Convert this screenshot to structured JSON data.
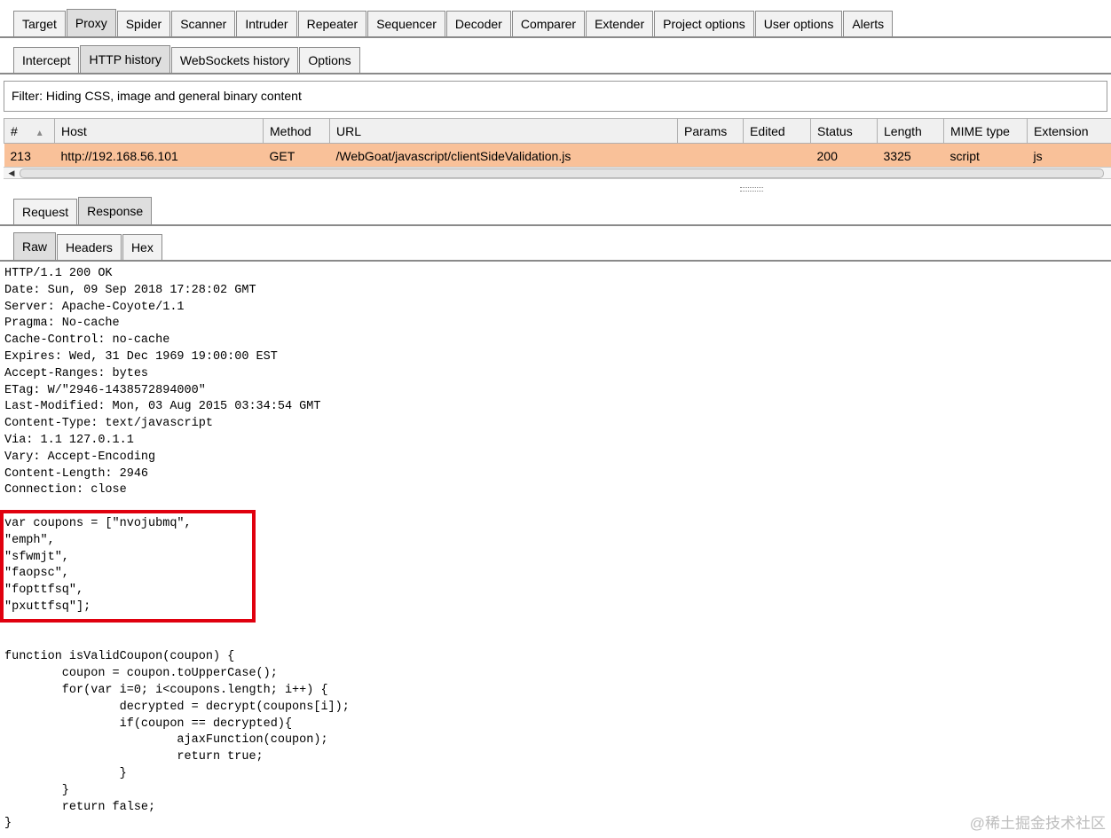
{
  "main_tabs": [
    "Target",
    "Proxy",
    "Spider",
    "Scanner",
    "Intruder",
    "Repeater",
    "Sequencer",
    "Decoder",
    "Comparer",
    "Extender",
    "Project options",
    "User options",
    "Alerts"
  ],
  "main_active": "Proxy",
  "proxy_tabs": [
    "Intercept",
    "HTTP history",
    "WebSockets history",
    "Options"
  ],
  "proxy_active": "HTTP history",
  "filter_text": "Filter: Hiding CSS, image and general binary content",
  "table": {
    "columns": [
      "#",
      "Host",
      "Method",
      "URL",
      "Params",
      "Edited",
      "Status",
      "Length",
      "MIME type",
      "Extension"
    ],
    "rows": [
      [
        "213",
        "http://192.168.56.101",
        "GET",
        "/WebGoat/javascript/clientSideValidation.js",
        "",
        "",
        "200",
        "3325",
        "script",
        "js"
      ]
    ],
    "selected_row_color": "#f9c199"
  },
  "message_tabs": [
    "Request",
    "Response"
  ],
  "message_active": "Response",
  "view_tabs": [
    "Raw",
    "Headers",
    "Hex"
  ],
  "view_active": "Raw",
  "response_lines": [
    "HTTP/1.1 200 OK",
    "Date: Sun, 09 Sep 2018 17:28:02 GMT",
    "Server: Apache-Coyote/1.1",
    "Pragma: No-cache",
    "Cache-Control: no-cache",
    "Expires: Wed, 31 Dec 1969 19:00:00 EST",
    "Accept-Ranges: bytes",
    "ETag: W/\"2946-1438572894000\"",
    "Last-Modified: Mon, 03 Aug 2015 03:34:54 GMT",
    "Content-Type: text/javascript",
    "Via: 1.1 127.0.1.1",
    "Vary: Accept-Encoding",
    "Content-Length: 2946",
    "Connection: close",
    "",
    "var coupons = [\"nvojubmq\",",
    "\"emph\",",
    "\"sfwmjt\",",
    "\"faopsc\",",
    "\"fopttfsq\",",
    "\"pxuttfsq\"];",
    "",
    "",
    "function isValidCoupon(coupon) {",
    "        coupon = coupon.toUpperCase();",
    "        for(var i=0; i<coupons.length; i++) {",
    "                decrypted = decrypt(coupons[i]);",
    "                if(coupon == decrypted){",
    "                        ajaxFunction(coupon);",
    "                        return true;",
    "                }",
    "        }",
    "        return false;",
    "}"
  ],
  "highlight_color": "#e0000e",
  "watermark": "@稀土掘金技术社区"
}
